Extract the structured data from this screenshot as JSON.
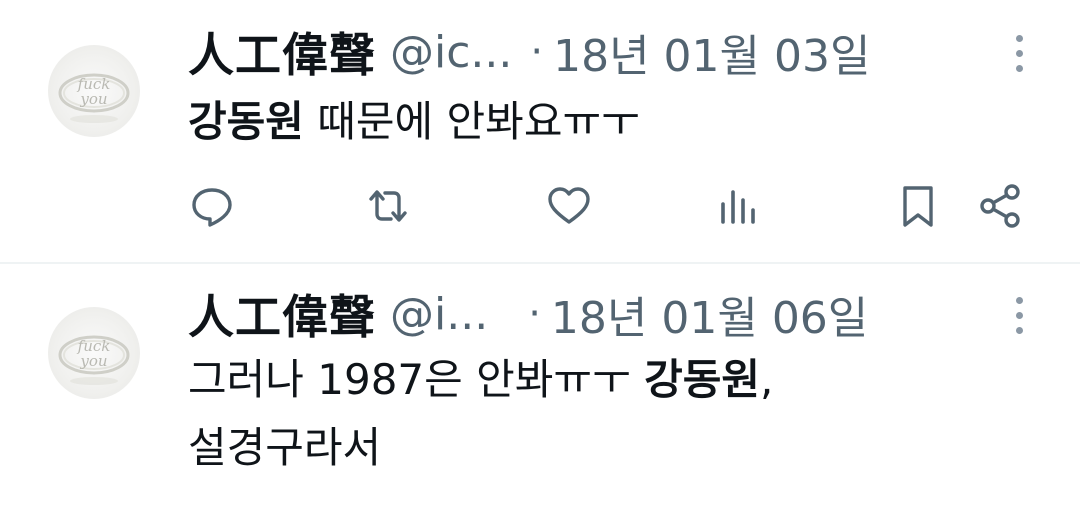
{
  "tweets": [
    {
      "author": {
        "display_name": "人工偉聲",
        "handle": "@ic...",
        "avatar_icon": "ring-avatar-icon"
      },
      "separator": "·",
      "date": "18년 01월 03일",
      "text_parts": [
        {
          "text": "강동원",
          "bold": true
        },
        {
          "text": " 때문에 안봐요ㅠㅜ",
          "bold": false
        }
      ],
      "actions": [
        "reply-icon",
        "retweet-icon",
        "like-icon",
        "views-icon",
        "bookmark-icon",
        "share-icon"
      ]
    },
    {
      "author": {
        "display_name": "人工偉聲",
        "handle": "@i...",
        "avatar_icon": "ring-avatar-icon"
      },
      "separator": "·",
      "date": "18년 01월 06일",
      "text_lines": [
        [
          {
            "text": "그러나 1987은 안봐ㅠㅜ ",
            "bold": false
          },
          {
            "text": "강동원",
            "bold": true
          },
          {
            "text": ",",
            "bold": false
          }
        ],
        [
          {
            "text": "설경구라서",
            "bold": false
          }
        ]
      ]
    }
  ],
  "colors": {
    "text": "#0f1419",
    "secondary": "#536471",
    "icon": "#536471",
    "divider": "#eff3f4"
  }
}
